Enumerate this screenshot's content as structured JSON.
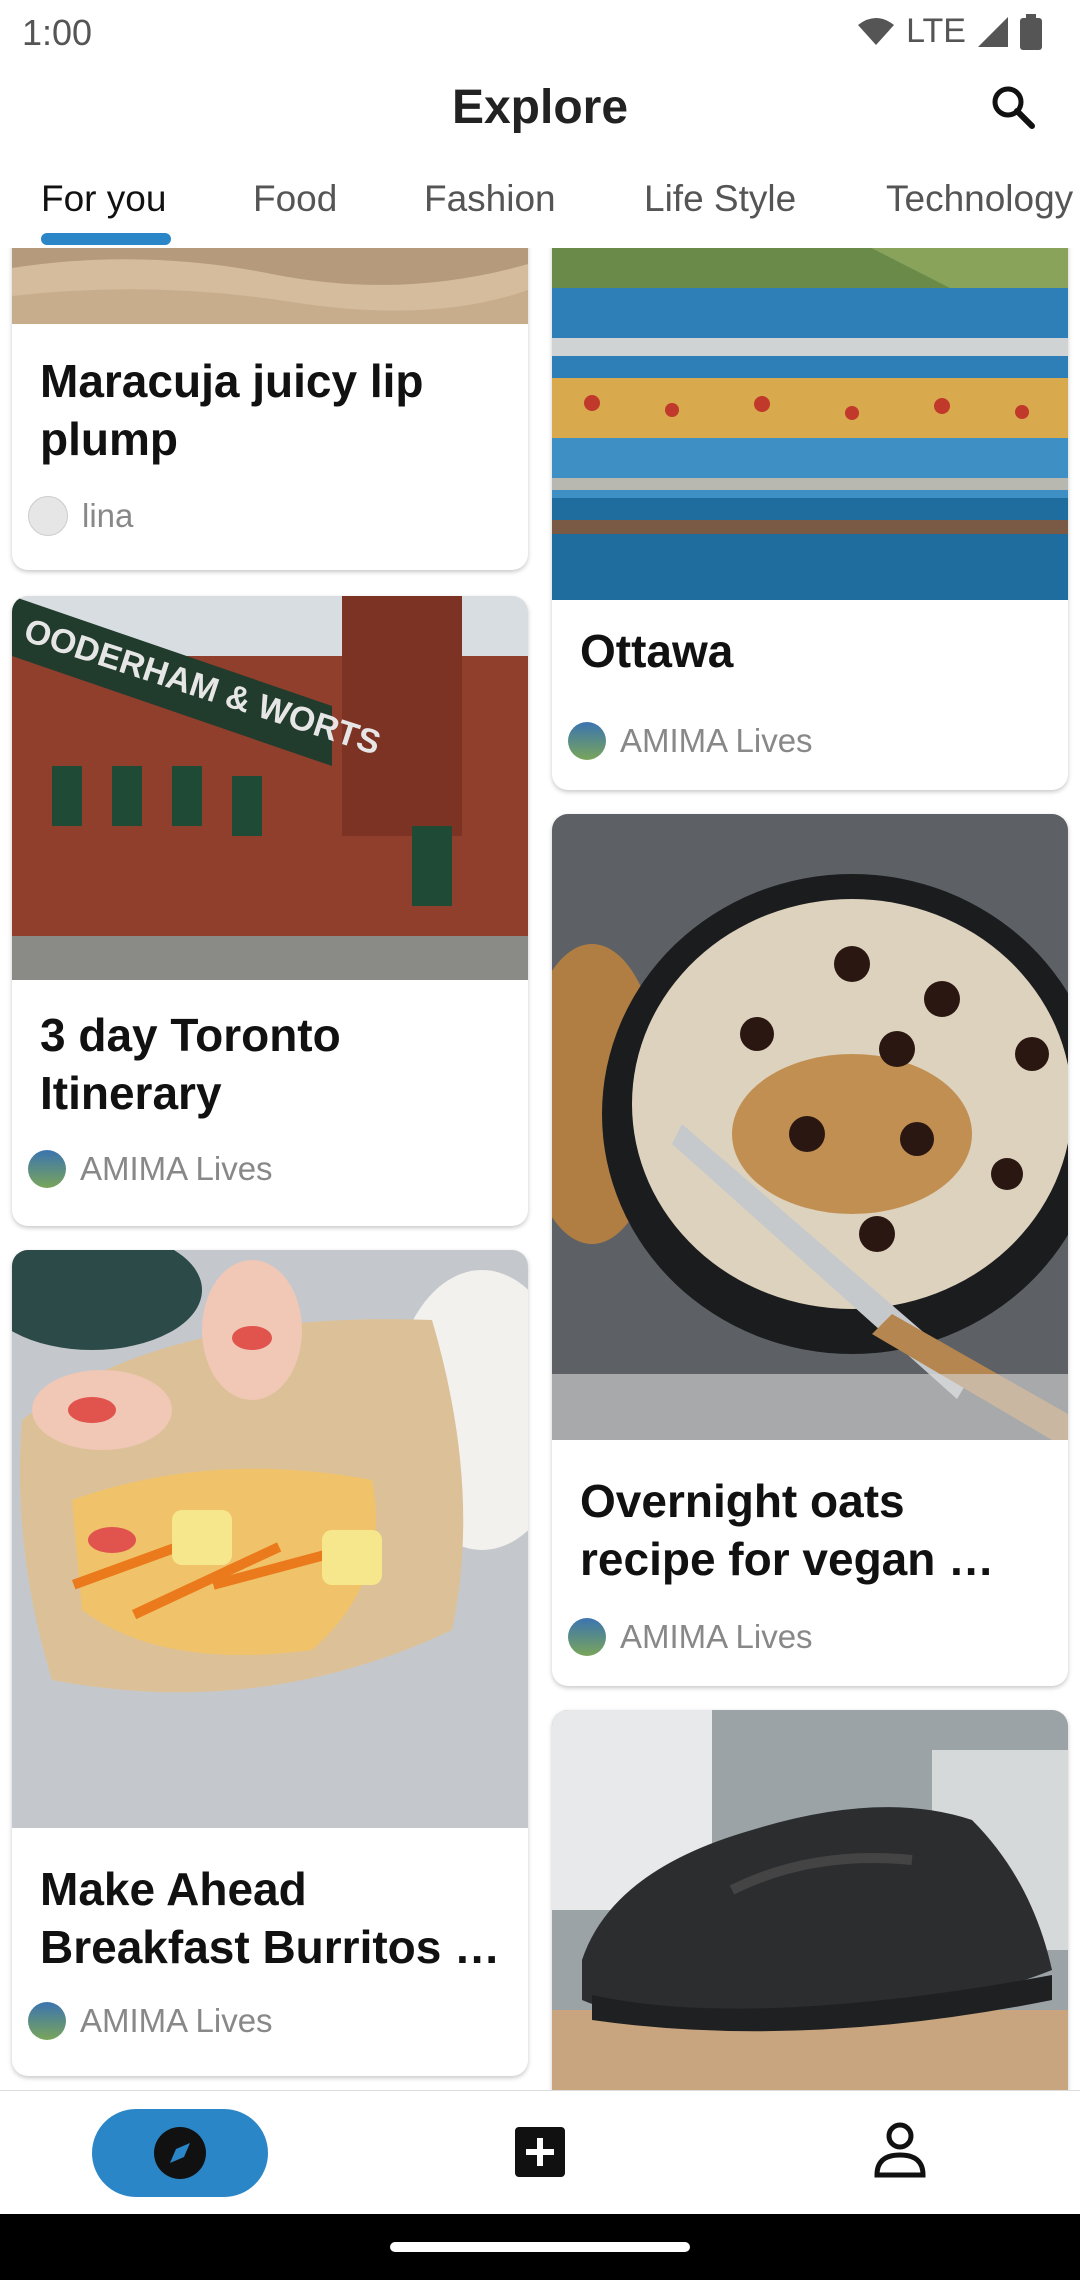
{
  "status": {
    "time": "1:00",
    "network": "LTE"
  },
  "header": {
    "title": "Explore"
  },
  "tabs": [
    "For you",
    "Food",
    "Fashion",
    "Life Style",
    "Technology"
  ],
  "cards": [
    {
      "title": "Maracuja juicy lip plump",
      "author": "lina",
      "image": "lip-product-image"
    },
    {
      "title": "Ottawa",
      "author": "AMIMA Lives",
      "image": "canal-bridge-locks-image"
    },
    {
      "title": "3 day Toronto Itinerary",
      "author": "AMIMA Lives",
      "image": "distillery-building-image"
    },
    {
      "title": "Overnight oats recipe for vegan …",
      "author": "AMIMA Lives",
      "image": "oats-bowl-image"
    },
    {
      "title": "Make Ahead Breakfast Burritos …",
      "author": "AMIMA Lives",
      "image": "burrito-image"
    },
    {
      "title": "",
      "author": "",
      "image": "black-sneaker-image"
    }
  ],
  "bottom_nav": [
    "explore",
    "add",
    "profile"
  ],
  "colors": {
    "accent": "#2b86c8",
    "text": "#111111",
    "muted": "#888888"
  }
}
